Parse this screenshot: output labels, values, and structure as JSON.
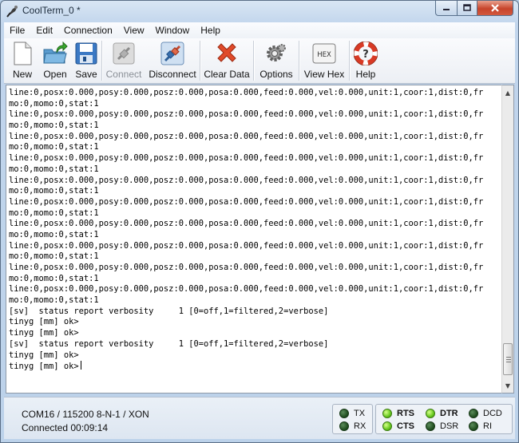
{
  "window": {
    "title": "CoolTerm_0 *"
  },
  "menu": [
    "File",
    "Edit",
    "Connection",
    "View",
    "Window",
    "Help"
  ],
  "toolbar": {
    "new": "New",
    "open": "Open",
    "save": "Save",
    "connect": "Connect",
    "disconnect": "Disconnect",
    "clear_data": "Clear Data",
    "options": "Options",
    "view_hex": "View Hex",
    "help": "Help",
    "hex_icon_text": "HEX"
  },
  "terminal": {
    "lines": [
      "line:0,posx:0.000,posy:0.000,posz:0.000,posa:0.000,feed:0.000,vel:0.000,unit:1,coor:1,dist:0,fr",
      "mo:0,momo:0,stat:1",
      "line:0,posx:0.000,posy:0.000,posz:0.000,posa:0.000,feed:0.000,vel:0.000,unit:1,coor:1,dist:0,fr",
      "mo:0,momo:0,stat:1",
      "line:0,posx:0.000,posy:0.000,posz:0.000,posa:0.000,feed:0.000,vel:0.000,unit:1,coor:1,dist:0,fr",
      "mo:0,momo:0,stat:1",
      "line:0,posx:0.000,posy:0.000,posz:0.000,posa:0.000,feed:0.000,vel:0.000,unit:1,coor:1,dist:0,fr",
      "mo:0,momo:0,stat:1",
      "line:0,posx:0.000,posy:0.000,posz:0.000,posa:0.000,feed:0.000,vel:0.000,unit:1,coor:1,dist:0,fr",
      "mo:0,momo:0,stat:1",
      "line:0,posx:0.000,posy:0.000,posz:0.000,posa:0.000,feed:0.000,vel:0.000,unit:1,coor:1,dist:0,fr",
      "mo:0,momo:0,stat:1",
      "line:0,posx:0.000,posy:0.000,posz:0.000,posa:0.000,feed:0.000,vel:0.000,unit:1,coor:1,dist:0,fr",
      "mo:0,momo:0,stat:1",
      "line:0,posx:0.000,posy:0.000,posz:0.000,posa:0.000,feed:0.000,vel:0.000,unit:1,coor:1,dist:0,fr",
      "mo:0,momo:0,stat:1",
      "line:0,posx:0.000,posy:0.000,posz:0.000,posa:0.000,feed:0.000,vel:0.000,unit:1,coor:1,dist:0,fr",
      "mo:0,momo:0,stat:1",
      "line:0,posx:0.000,posy:0.000,posz:0.000,posa:0.000,feed:0.000,vel:0.000,unit:1,coor:1,dist:0,fr",
      "mo:0,momo:0,stat:1",
      "[sv]  status report verbosity     1 [0=off,1=filtered,2=verbose]",
      "tinyg [mm] ok>",
      "tinyg [mm] ok>",
      "[sv]  status report verbosity     1 [0=off,1=filtered,2=verbose]",
      "tinyg [mm] ok>",
      "tinyg [mm] ok>"
    ]
  },
  "status": {
    "port_settings": "COM16 / 115200 8-N-1 / XON",
    "connection": "Connected 00:09:14"
  },
  "leds": {
    "tx": {
      "label": "TX",
      "on": false
    },
    "rx": {
      "label": "RX",
      "on": false
    },
    "rts": {
      "label": "RTS",
      "on": true
    },
    "cts": {
      "label": "CTS",
      "on": true
    },
    "dtr": {
      "label": "DTR",
      "on": true
    },
    "dsr": {
      "label": "DSR",
      "on": false
    },
    "dcd": {
      "label": "DCD",
      "on": false
    },
    "ri": {
      "label": "RI",
      "on": false
    }
  },
  "colors": {
    "accent": "#c7442b",
    "led_on": "#66c81e",
    "led_off": "#1c4a1c"
  }
}
